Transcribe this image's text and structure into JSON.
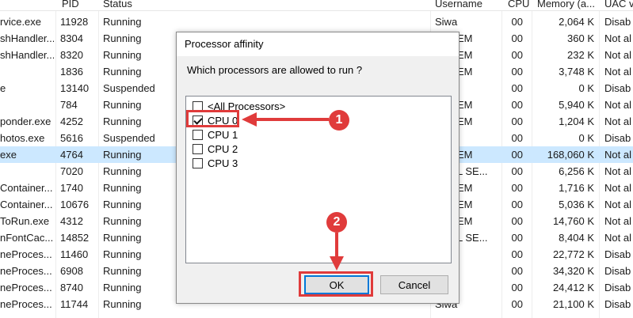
{
  "table": {
    "headers": {
      "pid": "PID",
      "status": "Status",
      "username": "Username",
      "cpu": "CPU",
      "memory": "Memory (a...",
      "uac": "UAC v"
    },
    "rows": [
      {
        "name": "rvice.exe",
        "pid": "11928",
        "status": "Running",
        "user": "Siwa",
        "cpu": "00",
        "mem": "2,064 K",
        "uac": "Disab"
      },
      {
        "name": "shHandler...",
        "pid": "8304",
        "status": "Running",
        "user": "EM",
        "cpu": "00",
        "mem": "360 K",
        "uac": "Not al"
      },
      {
        "name": "shHandler...",
        "pid": "8320",
        "status": "Running",
        "user": "EM",
        "cpu": "00",
        "mem": "232 K",
        "uac": "Not al"
      },
      {
        "name": "",
        "pid": "1836",
        "status": "Running",
        "user": "EM",
        "cpu": "00",
        "mem": "3,748 K",
        "uac": "Not al"
      },
      {
        "name": "e",
        "pid": "13140",
        "status": "Suspended",
        "user": "",
        "cpu": "00",
        "mem": "0 K",
        "uac": "Disab"
      },
      {
        "name": "",
        "pid": "784",
        "status": "Running",
        "user": "EM",
        "cpu": "00",
        "mem": "5,940 K",
        "uac": "Not al"
      },
      {
        "name": "ponder.exe",
        "pid": "4252",
        "status": "Running",
        "user": "EM",
        "cpu": "00",
        "mem": "1,204 K",
        "uac": "Not al"
      },
      {
        "name": "hotos.exe",
        "pid": "5616",
        "status": "Suspended",
        "user": "",
        "cpu": "00",
        "mem": "0 K",
        "uac": "Disab"
      },
      {
        "name": "exe",
        "pid": "4764",
        "status": "Running",
        "user": "EM",
        "cpu": "00",
        "mem": "168,060 K",
        "uac": "Not al"
      },
      {
        "name": "",
        "pid": "7020",
        "status": "Running",
        "user": "L SE...",
        "cpu": "00",
        "mem": "6,256 K",
        "uac": "Not al"
      },
      {
        "name": "Container...",
        "pid": "1740",
        "status": "Running",
        "user": "EM",
        "cpu": "00",
        "mem": "1,716 K",
        "uac": "Not al"
      },
      {
        "name": "Container...",
        "pid": "10676",
        "status": "Running",
        "user": "EM",
        "cpu": "00",
        "mem": "5,036 K",
        "uac": "Not al"
      },
      {
        "name": "ToRun.exe",
        "pid": "4312",
        "status": "Running",
        "user": "EM",
        "cpu": "00",
        "mem": "14,760 K",
        "uac": "Not al"
      },
      {
        "name": "nFontCac...",
        "pid": "14852",
        "status": "Running",
        "user": "L SE...",
        "cpu": "00",
        "mem": "8,404 K",
        "uac": "Not al"
      },
      {
        "name": "neProces...",
        "pid": "11460",
        "status": "Running",
        "user": "",
        "cpu": "00",
        "mem": "22,772 K",
        "uac": "Disab"
      },
      {
        "name": "neProces...",
        "pid": "6908",
        "status": "Running",
        "user": "",
        "cpu": "00",
        "mem": "34,320 K",
        "uac": "Disab"
      },
      {
        "name": "neProces...",
        "pid": "8740",
        "status": "Running",
        "user": "",
        "cpu": "00",
        "mem": "24,412 K",
        "uac": "Disab"
      },
      {
        "name": "neProces...",
        "pid": "11744",
        "status": "Running",
        "user": "Siwa",
        "cpu": "00",
        "mem": "21,100 K",
        "uac": "Disab"
      }
    ]
  },
  "dialog": {
    "title": "Processor affinity",
    "question": "Which processors are allowed to run ?",
    "options": [
      {
        "label": "<All Processors>",
        "checked": false
      },
      {
        "label": "CPU 0",
        "checked": true
      },
      {
        "label": "CPU 1",
        "checked": false
      },
      {
        "label": "CPU 2",
        "checked": false
      },
      {
        "label": "CPU 3",
        "checked": false
      }
    ],
    "ok_label": "OK",
    "cancel_label": "Cancel"
  },
  "annotations": {
    "step1": "1",
    "step2": "2",
    "color": "#e03b3b"
  }
}
